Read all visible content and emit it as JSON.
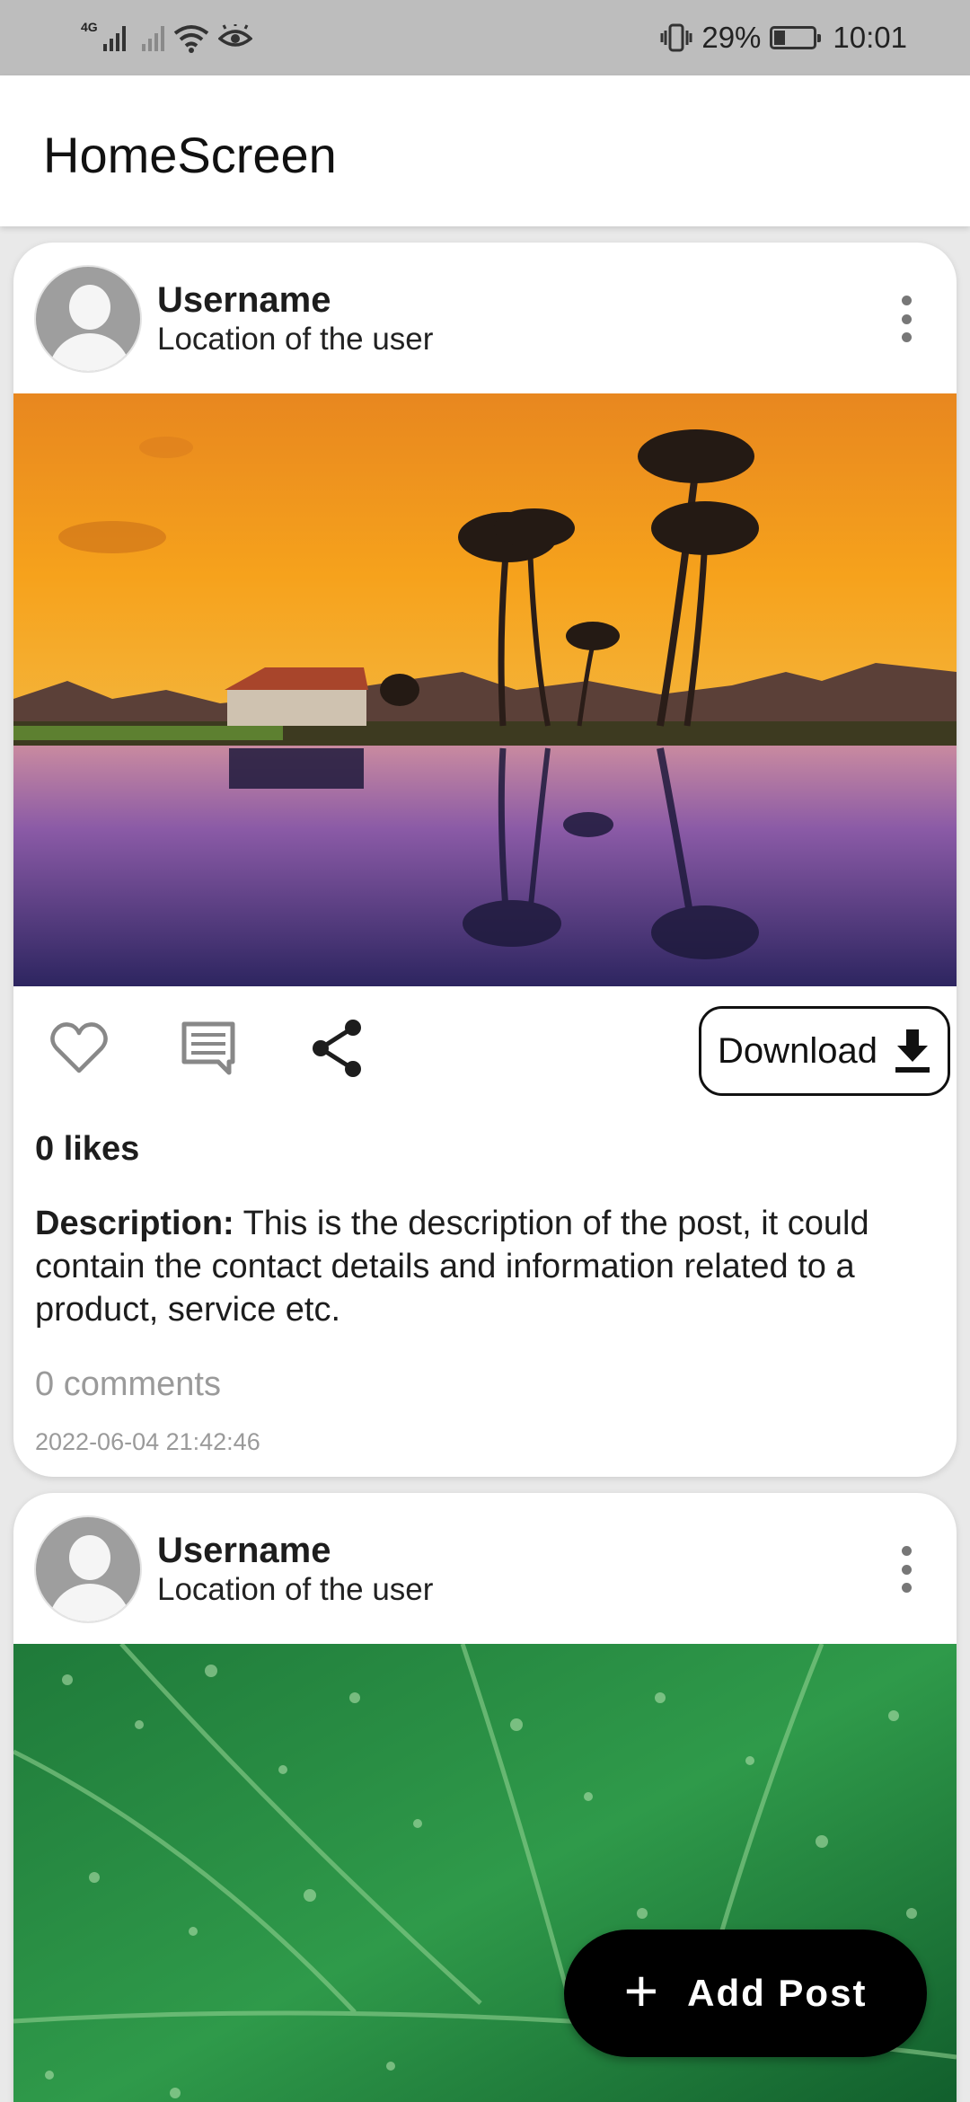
{
  "status_bar": {
    "network": "4G",
    "battery_percent": "29%",
    "time": "10:01"
  },
  "app_bar": {
    "title": "HomeScreen"
  },
  "posts": [
    {
      "username": "Username",
      "location": "Location of the user",
      "image_icon": "sunset-palm-lake-photo",
      "download_label": "Download",
      "likes_text": "0 likes",
      "description_label": "Description:",
      "description_text": " This is the description of the post, it could contain the contact details and information related to a product, service etc.",
      "comments_text": "0 comments",
      "timestamp": "2022-06-04 21:42:46"
    },
    {
      "username": "Username",
      "location": "Location of the user",
      "image_icon": "green-leaf-droplets-photo"
    }
  ],
  "fab": {
    "label": "Add Post",
    "icon": "plus-icon"
  },
  "colors": {
    "status_bar_bg": "#bdbdbd",
    "app_bar_bg": "#ffffff",
    "fab_bg": "#000000",
    "muted_text": "#9a9a9a"
  }
}
